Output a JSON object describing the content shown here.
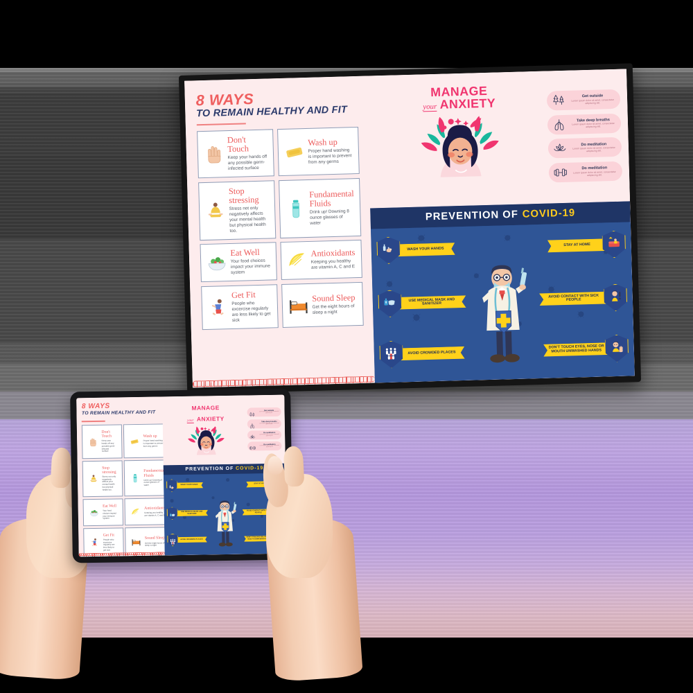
{
  "scene": {
    "description": "covid-19 prevention infographic shown on a wall-mounted tv and on a tablet held by two hands"
  },
  "infographic": {
    "header": {
      "line1": "8 WAYS",
      "line2": "TO REMAIN HEALTHY AND FIT"
    },
    "tiles": [
      {
        "icon": "hand-icon",
        "title": "Don't Touch",
        "text": "Keep your hands off any possible germ-infected surface"
      },
      {
        "icon": "soap-bar-icon",
        "title": "Wash up",
        "text": "Proper hand washing is important to prevent from any germs"
      },
      {
        "icon": "yoga-pose-icon",
        "title": "Stop stressing",
        "text": "Stress not only negatively affects your mental health but physical health too."
      },
      {
        "icon": "water-bottle-icon",
        "title": "Fundamental Fluids",
        "text": "Drink up! Downing 8 ounce glasses of water"
      },
      {
        "icon": "salad-bowl-icon",
        "title": "Eat Well",
        "text": "Your food choices impact your immune system"
      },
      {
        "icon": "lemon-slice-icon",
        "title": "Antioxidants",
        "text": "Keeping you healthy are vitamin A, C and E"
      },
      {
        "icon": "runner-icon",
        "title": "Get Fit",
        "text": "People who excercise regularly are less likely to get sick"
      },
      {
        "icon": "bed-icon",
        "title": "Sound Sleep",
        "text": "Get the eight hours of sleep a night"
      }
    ],
    "anxiety": {
      "title_line1": "MANAGE",
      "title_script": "your",
      "title_line2": "ANXIETY",
      "illustration": "woman-with-foliage-illustration",
      "cards": [
        {
          "icon": "trees-icon",
          "title": "Get outside",
          "text": "Lorem ipsum dolor sit amet, consectetur adipiscing elit."
        },
        {
          "icon": "lungs-icon",
          "title": "Take deep breaths",
          "text": "Lorem ipsum dolor sit amet, consectetur adipiscing elit."
        },
        {
          "icon": "lotus-icon",
          "title": "Do meditation",
          "text": "Lorem ipsum dolor sit amet, consectetur adipiscing elit."
        },
        {
          "icon": "dumbbell-icon",
          "title": "Do meditation",
          "text": "Lorem ipsum dolor sit amet, consectetur adipiscing elit."
        }
      ]
    },
    "covid": {
      "heading_white": "PREVENTION OF",
      "heading_yellow": "COVID-19",
      "center_illustration": "doctor-with-syringe-and-shield-illustration",
      "tips": [
        {
          "icon": "handwash-shield-icon",
          "label": "WASH YOUR HANDS",
          "side": "left"
        },
        {
          "icon": "sofa-home-shield-icon",
          "label": "STAY AT HOME",
          "side": "right"
        },
        {
          "icon": "mask-sanitizer-shield-icon",
          "label": "USE MEDICAL MASK AND SANITIZER",
          "side": "left"
        },
        {
          "icon": "sick-person-shield-icon",
          "label": "AVOID CONTACT WITH SICK PEOPLE",
          "side": "right"
        },
        {
          "icon": "crowd-shield-icon",
          "label": "AVOID CROWDED PLACES",
          "side": "left"
        },
        {
          "icon": "no-touch-face-shield-icon",
          "label": "DON'T TOUCH EYES, NOSE OR MOUTH UNWASHED HANDS",
          "side": "right"
        }
      ]
    }
  },
  "colors": {
    "pink_bg": "#fdeced",
    "coral_title": "#ec5a5a",
    "navy_text": "#2b3a6b",
    "magenta": "#f0356f",
    "card_pink": "#fbd3d9",
    "covid_header_navy": "#1f3566",
    "covid_body_blue": "#2f5596",
    "banner_yellow": "#ffd11a"
  }
}
